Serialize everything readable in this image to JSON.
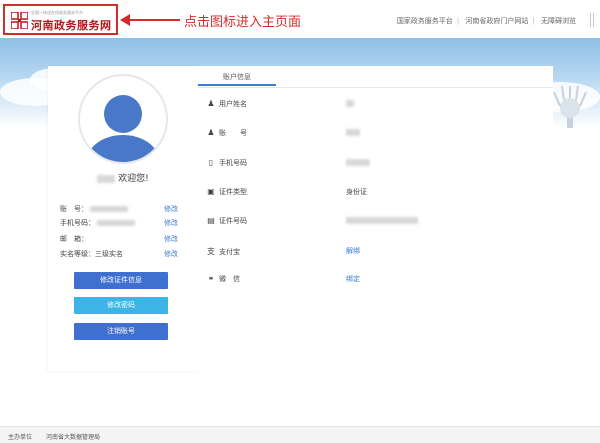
{
  "header": {
    "logo_subtitle": "全国一体化在线政务服务平台",
    "logo_title": "河南政务服务网",
    "annotation": "点击图标进入主页面",
    "links": [
      "国家政务服务平台",
      "河南省政府门户网站",
      "无障碍浏览"
    ]
  },
  "profile": {
    "welcome_suffix": "欢迎您!",
    "rows": [
      {
        "label": "账　号：",
        "edit": "修改"
      },
      {
        "label": "手机号码：",
        "edit": "修改"
      },
      {
        "label": "邮　箱：",
        "edit": "修改"
      },
      {
        "label": "实名等级：三级实名",
        "edit": "修改"
      }
    ],
    "buttons": {
      "edit_cert": "修改证件信息",
      "change_password": "修改密码",
      "cancel_account": "注销账号"
    }
  },
  "account": {
    "tab_label": "账户信息",
    "fields": [
      {
        "label": "用户姓名",
        "icon": "user-icon",
        "value": ""
      },
      {
        "label": "账　　号",
        "icon": "account-icon",
        "value": ""
      },
      {
        "label": "手机号码",
        "icon": "phone-icon",
        "value": ""
      },
      {
        "label": "证件类型",
        "icon": "id-card-icon",
        "value": "身份证"
      },
      {
        "label": "证件号码",
        "icon": "id-number-icon",
        "value": ""
      },
      {
        "label": "支付宝",
        "icon": "alipay-icon",
        "value": "解绑"
      },
      {
        "label": "微　信",
        "icon": "wechat-icon",
        "value": "绑定"
      }
    ]
  },
  "footer": {
    "sponsor_label": "主办单位",
    "sponsor_value": "河南省大数据管理局"
  },
  "colors": {
    "brand_red": "#b3151b",
    "annotation_red": "#d42a2a",
    "primary_blue": "#3f6fcf",
    "cyan": "#3cb4e6",
    "link_blue": "#3a7bd5"
  }
}
